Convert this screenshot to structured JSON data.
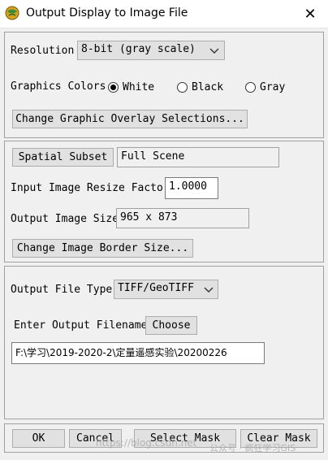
{
  "window": {
    "title": "Output Display to Image File",
    "close_label": "✕"
  },
  "display_panel": {
    "resolution_label": "Resolution",
    "resolution_value": "8-bit (gray scale)",
    "graphics_colors_label": "Graphics Colors",
    "color_options": [
      "White",
      "Black",
      "Gray"
    ],
    "selected_color": "White",
    "overlay_button": "Change Graphic Overlay Selections..."
  },
  "subset_panel": {
    "spatial_subset_button": "Spatial Subset",
    "spatial_subset_value": "Full Scene",
    "resize_label": "Input Image Resize Factor",
    "resize_value": "1.0000",
    "output_size_label": "Output Image Size",
    "output_size_value": "965 x 873",
    "border_button": "Change Image Border Size..."
  },
  "output_panel": {
    "file_type_label": "Output File Type",
    "file_type_value": "TIFF/GeoTIFF",
    "filename_label": "Enter Output Filename",
    "choose_button": "Choose",
    "filename_value": "F:\\学习\\2019-2020-2\\定量遥感实验\\20200226"
  },
  "footer": {
    "ok": "OK",
    "cancel": "Cancel",
    "select_mask": "Select Mask",
    "clear_mask": "Clear Mask"
  },
  "watermarks": {
    "left": "https://blog.csdn.net",
    "right": "公众号 · 疯狂学习GIS"
  }
}
